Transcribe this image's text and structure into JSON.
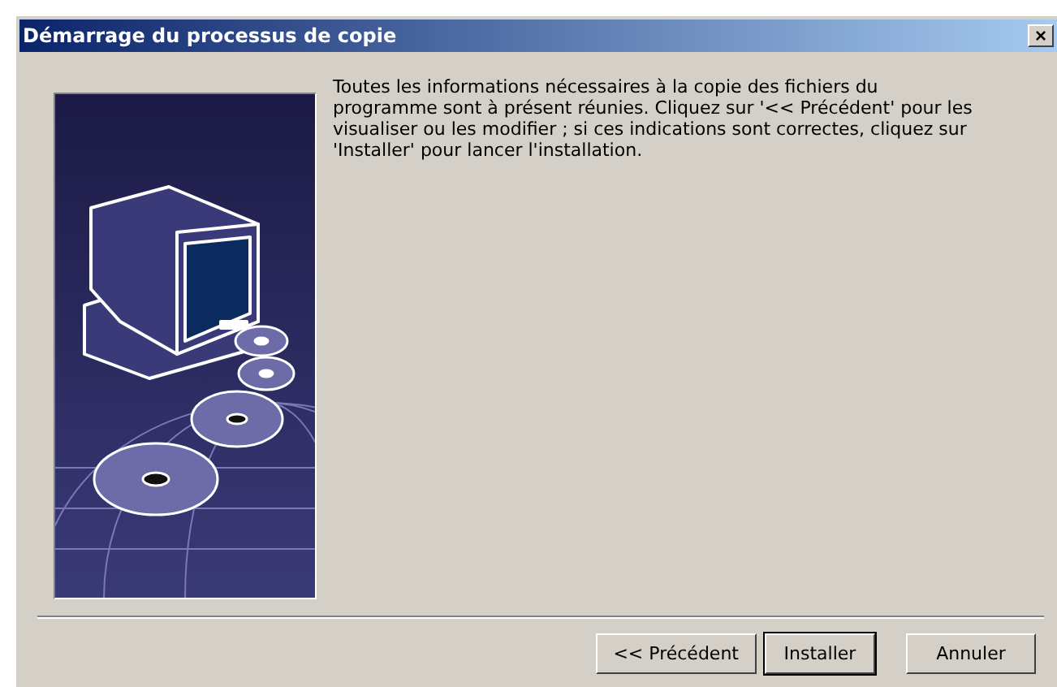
{
  "window": {
    "title": "Démarrage du processus de copie",
    "close": "×"
  },
  "message": "Toutes les informations nécessaires à la copie des fichiers du programme sont à présent réunies. Cliquez sur '<< Précédent' pour les visualiser ou les modifier ; si ces indications sont correctes, cliquez sur 'Installer' pour lancer l'installation.",
  "buttons": [
    {
      "label": "<< Précédent",
      "default": false
    },
    {
      "label": "Installer",
      "default": true
    },
    {
      "label": "Annuler",
      "default": false
    }
  ]
}
